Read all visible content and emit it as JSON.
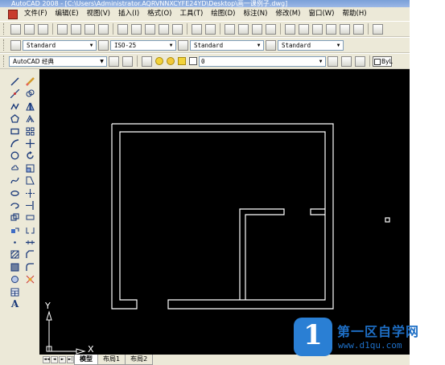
{
  "window": {
    "title": "AutoCAD 2008 - [C:\\Users\\Administrator.AQRVNNXCYFE24YD\\Desktop\\画一课例子.dwg]"
  },
  "menu": [
    "文件(F)",
    "编辑(E)",
    "视图(V)",
    "插入(I)",
    "格式(O)",
    "工具(T)",
    "绘图(D)",
    "标注(N)",
    "修改(M)",
    "窗口(W)",
    "帮助(H)"
  ],
  "styles_toolbar": {
    "text_style": "Standard",
    "dim_style": "ISO-25",
    "table_style": "Standard",
    "multileader_style": "Standard"
  },
  "layers_toolbar": {
    "workspace": "AutoCAD 经典",
    "current_layer": "0",
    "linetype_value": "ByL"
  },
  "ucs": {
    "y_label": "Y",
    "x_label": "X"
  },
  "tabs": [
    "模型",
    "布局1",
    "布局2"
  ],
  "tab_nav": [
    "◄◄",
    "◄",
    "►",
    "►|"
  ],
  "watermark": {
    "title": "第一区自学网",
    "url": "www.d1qu.com",
    "logo_glyph": "1"
  },
  "left_tools": {
    "text_tool_label": "A"
  }
}
